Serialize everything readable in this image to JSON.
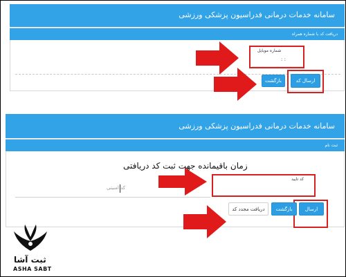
{
  "top_panel": {
    "title": "سامانه خدمات درمانی فدراسیون پزشکی ورزشی",
    "strip_label": "دریافت کد با شماره همراه",
    "mobile_label": "شماره موبایل",
    "send_button": "ارسال کد",
    "back_button": "بازگشت"
  },
  "bottom_panel": {
    "title": "سامانه خدمات درمانی فدراسیون پزشکی ورزشی",
    "strip_label": "ثبت نام",
    "overlay_caption": "زمان باقیمانده جهت ثبت کد دریافتی",
    "code_label": "کد تایید",
    "code_placeholder": "کد امنیتی",
    "submit_button": "ارسال",
    "back_button": "بازگشت",
    "resend_button": "دریافت مجدد کد"
  },
  "logo": {
    "text_fa": "ثبت آشا",
    "text_en": "ASHA SABT"
  },
  "colors": {
    "header_blue": "#33a3e8",
    "button_blue": "#2e9ee4",
    "highlight_red": "#d62020",
    "arrow_red": "#e01a1a"
  }
}
